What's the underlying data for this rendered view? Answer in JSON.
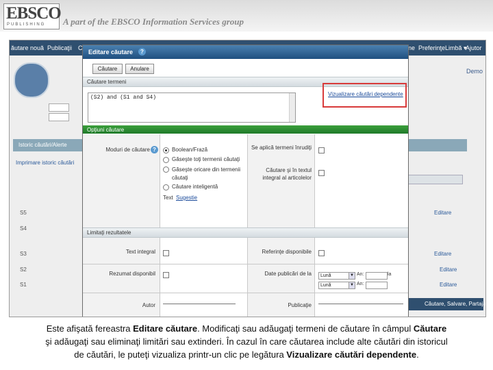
{
  "header": {
    "logo_big": "EBSCO",
    "logo_small": "PUBLISHING",
    "tagline": "A part of the EBSCO Information Services group"
  },
  "background": {
    "nav_items": [
      "ăutare nouă",
      "Publicaţii",
      "C",
      "ne",
      "Preferinţe",
      "Limbă ▾",
      "Ajutor"
    ],
    "demo": "Demo",
    "history_bar": "Istoric căutări/Alerte",
    "print_history": "Imprimare istoric căutări",
    "rows": [
      "S5",
      "S4",
      "S3",
      "S2",
      "S1"
    ],
    "edit": "Editare",
    "footer": "Căutare, Salvare, Partajare"
  },
  "dialog": {
    "title": "Editare căutare",
    "search_button": "Căutare",
    "cancel_button": "Anulare",
    "search_terms_label": "Căutare termeni",
    "search_terms_value": "(S2) and (S1 and S4)",
    "view_dependent_link": "Vizualizare căutări dependente",
    "search_options_bar": "Opţiuni căutare",
    "search_modes_label": "Moduri de căutare",
    "modes": [
      "Boolean/Frază",
      "Găseşte toţi termenii căutaţi",
      "Găseşte oricare din termenii căutaţi",
      "Căutare inteligentă"
    ],
    "hint_prefix": "Text",
    "hint_link": "Sugestie",
    "related_terms": "Se aplică termeni înrudiţi",
    "fulltext_search": "Căutare şi în textul integral al articolelor",
    "limits_bar": "Limitaţi rezultatele",
    "full_text": "Text integral",
    "references_available": "Referinţe disponibile",
    "abstract_available": "Rezumat disponibil",
    "pub_date": "Date publicări de la",
    "month_from": "Lună",
    "month_to": "Lună",
    "year_label": "An:",
    "to_label": "la",
    "author": "Autor",
    "publication": "Publicaţie"
  },
  "caption": {
    "line1_a": "Este afişată fereastra ",
    "line1_b": "Editare căutare",
    "line1_c": ". Modificaţi sau adăugaţi termeni de căutare în câmpul ",
    "line1_d": "Căutare",
    "line2": "şi adăugaţi sau eliminaţi limitări sau extinderi. În cazul în care căutarea include alte căutări din istoricul",
    "line3_a": "de căutări, le puteţi vizualiza printr-un clic pe legătura ",
    "line3_b": "Vizualizare căutări dependente",
    "line3_c": "."
  }
}
